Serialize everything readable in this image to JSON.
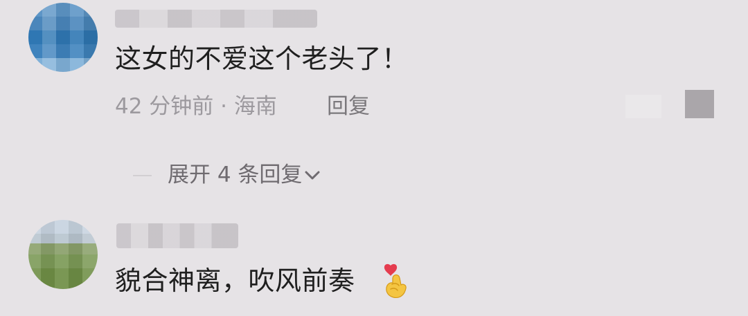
{
  "comments": [
    {
      "text": "这女的不爱这个老头了！",
      "meta": "42 分钟前 · 海南",
      "reply_label": "回复",
      "expand_label": "展开 4 条回复"
    },
    {
      "text": "貌合神离，吹风前奏"
    }
  ],
  "colors": {
    "background": "#e6e3e6",
    "primary_text": "#1f1f1f",
    "meta_text": "#9c999e",
    "expand_text": "#6f6b70"
  },
  "icons": {
    "expand": "chevron-down-icon",
    "emoji": "finger-heart-emoji"
  }
}
